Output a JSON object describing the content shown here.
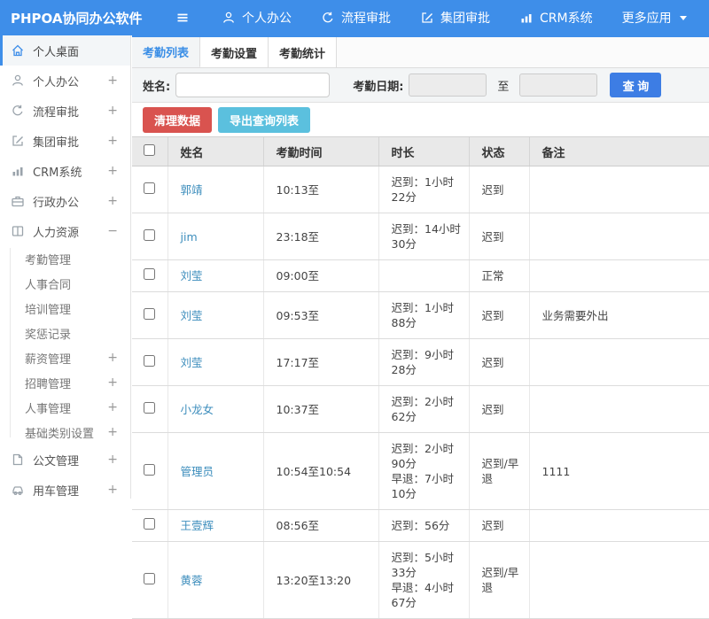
{
  "colors": {
    "header_bg": "#3E8EE9",
    "accent_blue": "#3A8EE6",
    "search_button_bg": "#3D7DE4",
    "danger_button_bg": "#D9534F",
    "info_button_bg": "#5BC0DE",
    "link_blue": "#3C8DBC",
    "status_red": "#D9534F"
  },
  "header": {
    "logo": "PHPOA协同办公软件",
    "items": [
      {
        "label": "个人办公",
        "icon": "user-icon"
      },
      {
        "label": "流程审批",
        "icon": "process-icon"
      },
      {
        "label": "集团审批",
        "icon": "approval-icon"
      },
      {
        "label": "CRM系统",
        "icon": "chart-icon"
      },
      {
        "label": "更多应用",
        "icon": "caret-down-icon"
      }
    ]
  },
  "sidebar": {
    "items": [
      {
        "label": "个人桌面",
        "icon": "home-icon",
        "expand": "",
        "active": true
      },
      {
        "label": "个人办公",
        "icon": "user-icon",
        "expand": "+"
      },
      {
        "label": "流程审批",
        "icon": "process-icon",
        "expand": "+"
      },
      {
        "label": "集团审批",
        "icon": "approval-icon",
        "expand": "+"
      },
      {
        "label": "CRM系统",
        "icon": "chart-icon",
        "expand": "+"
      },
      {
        "label": "行政办公",
        "icon": "briefcase-icon",
        "expand": "+"
      },
      {
        "label": "人力资源",
        "icon": "hr-book-icon",
        "expand": "−"
      },
      {
        "label": "公文管理",
        "icon": "document-icon",
        "expand": "+"
      },
      {
        "label": "用车管理",
        "icon": "car-icon",
        "expand": "+"
      }
    ],
    "hr_children": [
      {
        "label": "考勤管理",
        "expand": ""
      },
      {
        "label": "人事合同",
        "expand": ""
      },
      {
        "label": "培训管理",
        "expand": ""
      },
      {
        "label": "奖惩记录",
        "expand": ""
      },
      {
        "label": "薪资管理",
        "expand": "+"
      },
      {
        "label": "招聘管理",
        "expand": "+"
      },
      {
        "label": "人事管理",
        "expand": "+"
      },
      {
        "label": "基础类别设置",
        "expand": "+"
      }
    ]
  },
  "tabs": [
    {
      "label": "考勤列表",
      "active": true
    },
    {
      "label": "考勤设置",
      "active": false
    },
    {
      "label": "考勤统计",
      "active": false
    }
  ],
  "filter": {
    "name_label": "姓名:",
    "name_value": "",
    "date_label": "考勤日期:",
    "date_from_value": "",
    "to_label": "至",
    "date_to_value": "",
    "search_button": "查 询"
  },
  "actions": {
    "clear_button": "清理数据",
    "export_button": "导出查询列表"
  },
  "table": {
    "headers": [
      "姓名",
      "考勤时间",
      "时长",
      "状态",
      "备注"
    ],
    "rows": [
      {
        "name": "郭靖",
        "time": "10:13至",
        "duration": [
          "迟到：1小时22分"
        ],
        "status": "迟到",
        "status_type": "late",
        "note": ""
      },
      {
        "name": "jim",
        "time": "23:18至",
        "duration": [
          "迟到：14小时30分"
        ],
        "status": "迟到",
        "status_type": "late",
        "note": ""
      },
      {
        "name": "刘莹",
        "time": "09:00至",
        "duration": [],
        "status": "正常",
        "status_type": "normal",
        "note": ""
      },
      {
        "name": "刘莹",
        "time": "09:53至",
        "duration": [
          "迟到：1小时88分"
        ],
        "status": "迟到",
        "status_type": "late",
        "note": "业务需要外出"
      },
      {
        "name": "刘莹",
        "time": "17:17至",
        "duration": [
          "迟到：9小时28分"
        ],
        "status": "迟到",
        "status_type": "late",
        "note": ""
      },
      {
        "name": "小龙女",
        "time": "10:37至",
        "duration": [
          "迟到：2小时62分"
        ],
        "status": "迟到",
        "status_type": "late",
        "note": ""
      },
      {
        "name": "管理员",
        "time": "10:54至10:54",
        "duration": [
          "迟到：2小时90分",
          "早退：7小时10分"
        ],
        "status": "迟到/早退",
        "status_type": "late_early",
        "note": "1111"
      },
      {
        "name": "王壹辉",
        "time": "08:56至",
        "duration": [
          "迟到：56分"
        ],
        "status": "迟到",
        "status_type": "late",
        "note": ""
      },
      {
        "name": "黄蓉",
        "time": "13:20至13:20",
        "duration": [
          "迟到：5小时33分",
          "早退：4小时67分"
        ],
        "status": "迟到/早退",
        "status_type": "late_early",
        "note": ""
      }
    ]
  }
}
